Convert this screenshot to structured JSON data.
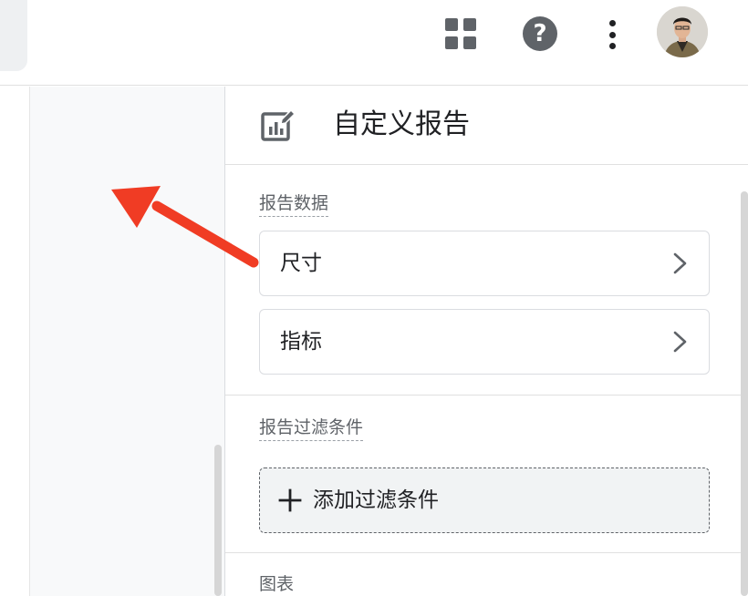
{
  "topbar": {
    "apps_icon": "apps-grid-icon",
    "help_icon": "help-icon",
    "help_glyph": "?",
    "more_icon": "more-vert-icon",
    "avatar": "user-avatar"
  },
  "panel": {
    "title": "自定义报告",
    "title_icon": "report-edit-icon",
    "report_data": {
      "label": "报告数据",
      "items": [
        {
          "label": "尺寸",
          "icon": "chevron-right-icon"
        },
        {
          "label": "指标",
          "icon": "chevron-right-icon"
        }
      ]
    },
    "report_filters": {
      "label": "报告过滤条件",
      "add_button": {
        "label": "添加过滤条件",
        "icon": "plus-icon"
      }
    },
    "chart": {
      "label": "图表"
    }
  },
  "colors": {
    "annotation_arrow": "#f03c24",
    "icon_gray": "#5f6368",
    "canvas_bg": "#f8f9fa"
  }
}
